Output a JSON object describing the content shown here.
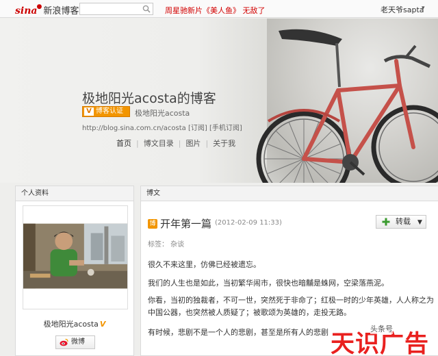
{
  "topbar": {
    "logo_brand": "sina",
    "logo_text": "新浪博客",
    "search_placeholder": "",
    "promo_link": "周星驰新片《美人鱼》 无敌了",
    "username": "老天爷sapta"
  },
  "header": {
    "blog_title": "极地阳光acosta的博客",
    "cert_label": "博客认证",
    "cert_v": "V",
    "cert_name": "极地阳光acosta",
    "url": "http://blog.sina.com.cn/acosta",
    "subscribe": "[订阅]",
    "mobile_subscribe": "[手机订阅]",
    "nav": [
      "首页",
      "博文目录",
      "图片",
      "关于我"
    ]
  },
  "sidebar": {
    "heading": "个人资料",
    "profile_name": "极地阳光acosta",
    "weibo_label": "微博"
  },
  "main": {
    "heading": "博文",
    "post_icon": "博",
    "post_title": "开年第一篇",
    "post_date": "(2012-02-09 11:33)",
    "share_label": "转载",
    "tags": "标签： 杂谈",
    "paragraphs": [
      "很久不来这里，仿佛已经被遗忘。",
      "我们的人生也是如此，当初繁华闹市，很快也暗黼是蛛网，空梁落燕泥。",
      "你看，当初的独裁者，不可一世，突然死于非命了；红极一时的少年英雄，人人称之为中国公器，也突然被人质疑了；被歌颂为英雄的，走投无路。",
      "有时候，悲剧不是一个人的悲剧，甚至是所有人的悲剧"
    ]
  },
  "watermark": {
    "text": "天识广告",
    "small": "头条号"
  },
  "icons": {
    "search": "search-icon",
    "weibo": "weibo-icon",
    "plus": "plus-icon",
    "caret": "chevron-down-icon"
  },
  "colors": {
    "brand_red": "#d20000",
    "cert_orange": "#f29500",
    "watermark_red": "#e9211f"
  }
}
